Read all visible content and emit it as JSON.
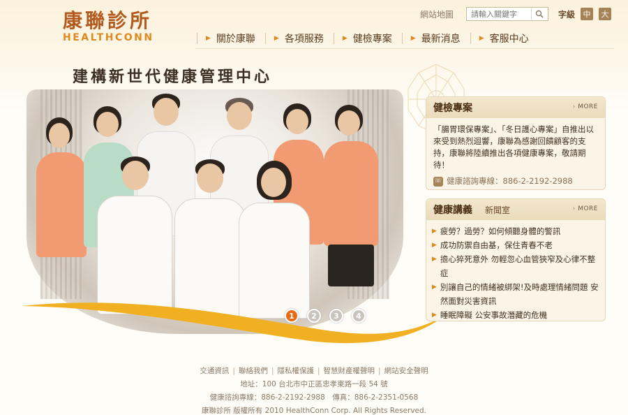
{
  "header": {
    "logo_cn": "康聯診所",
    "logo_en": "HEALTHCONN",
    "sitemap": "網站地圖",
    "search_placeholder": "請輸入關鍵字",
    "font_size_label": "字級",
    "font_size_medium": "中",
    "font_size_large": "大"
  },
  "nav": {
    "items": [
      {
        "label": "關於康聯"
      },
      {
        "label": "各項服務"
      },
      {
        "label": "健檢專案"
      },
      {
        "label": "最新消息"
      },
      {
        "label": "客服中心"
      }
    ]
  },
  "hero": {
    "title": "建構新世代健康管理中心",
    "pager": [
      "1",
      "2",
      "3",
      "4"
    ],
    "active_page": 1
  },
  "checkup_panel": {
    "title": "健檢專案",
    "more": "MORE",
    "body": "「腸胃環保專案」、「冬日護心專案」自推出以來受到熱烈迴響，康聯為感謝回饋顧客的支持，康聯將陸續推出各項健康專案，敬請期待！",
    "hotline": "健康諮詢專線：886-2-2192-2988"
  },
  "news_panel": {
    "title": "健康講義",
    "subtab": "新聞室",
    "more": "MORE",
    "items": [
      "疲勞？過勞？如何傾聽身體的警訊",
      "成功防禦自由基，保住青春不老",
      "擔心猝死意外 勿輕忽心血管狹窄及心律不整症",
      "別讓自己的情緒被綁架!及時處理情緒問題 安然面對災害資訊",
      "睡眠障礙 公安事故潛藏的危機"
    ]
  },
  "footer": {
    "links": [
      "交通資訊",
      "聯絡我們",
      "隱私權保護",
      "智慧財產權聲明",
      "網站安全聲明"
    ],
    "address": "地址：100 台北市中正區忠孝東路一段 54 號",
    "contact": "健康諮詢專線：886-2-2192-2988　傳真：886-2-2351-0568",
    "copyright": "康聯診所 版權所有 2010 HealthConn Corp. All Rights Reserved."
  },
  "colors": {
    "brand": "#b35a1f",
    "accent": "#e08a1e",
    "active_dot": "#e86a12",
    "panel_bg": "#fbf5e8"
  }
}
